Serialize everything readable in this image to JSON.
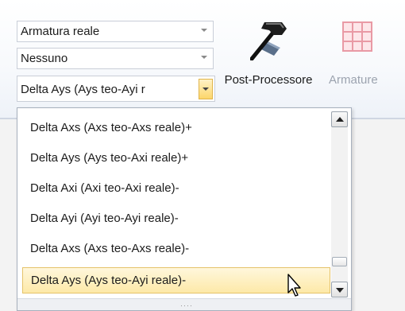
{
  "combos": [
    {
      "value": "Armatura reale"
    },
    {
      "value": "Nessuno"
    },
    {
      "value": "Delta Ays (Ays teo-Ayi r"
    }
  ],
  "ribbon": {
    "post_label": "Post-Processore",
    "armature_label": "Armature"
  },
  "dropdown": {
    "items": [
      {
        "label": "Delta Axs (Axs teo-Axs reale)+"
      },
      {
        "label": "Delta Ays (Ays teo-Axi reale)+"
      },
      {
        "label": "Delta Axi (Axi teo-Axi reale)-"
      },
      {
        "label": "Delta Ayi (Ayi teo-Ayi reale)-"
      },
      {
        "label": "Delta Axs (Axs teo-Axs reale)-"
      },
      {
        "label": "Delta Ays (Ays teo-Ayi reale)-"
      }
    ],
    "selected_index": 5,
    "grip": "····"
  },
  "colors": {
    "highlight": "#fde9a8",
    "dropdown_button": "#fcd66a"
  }
}
